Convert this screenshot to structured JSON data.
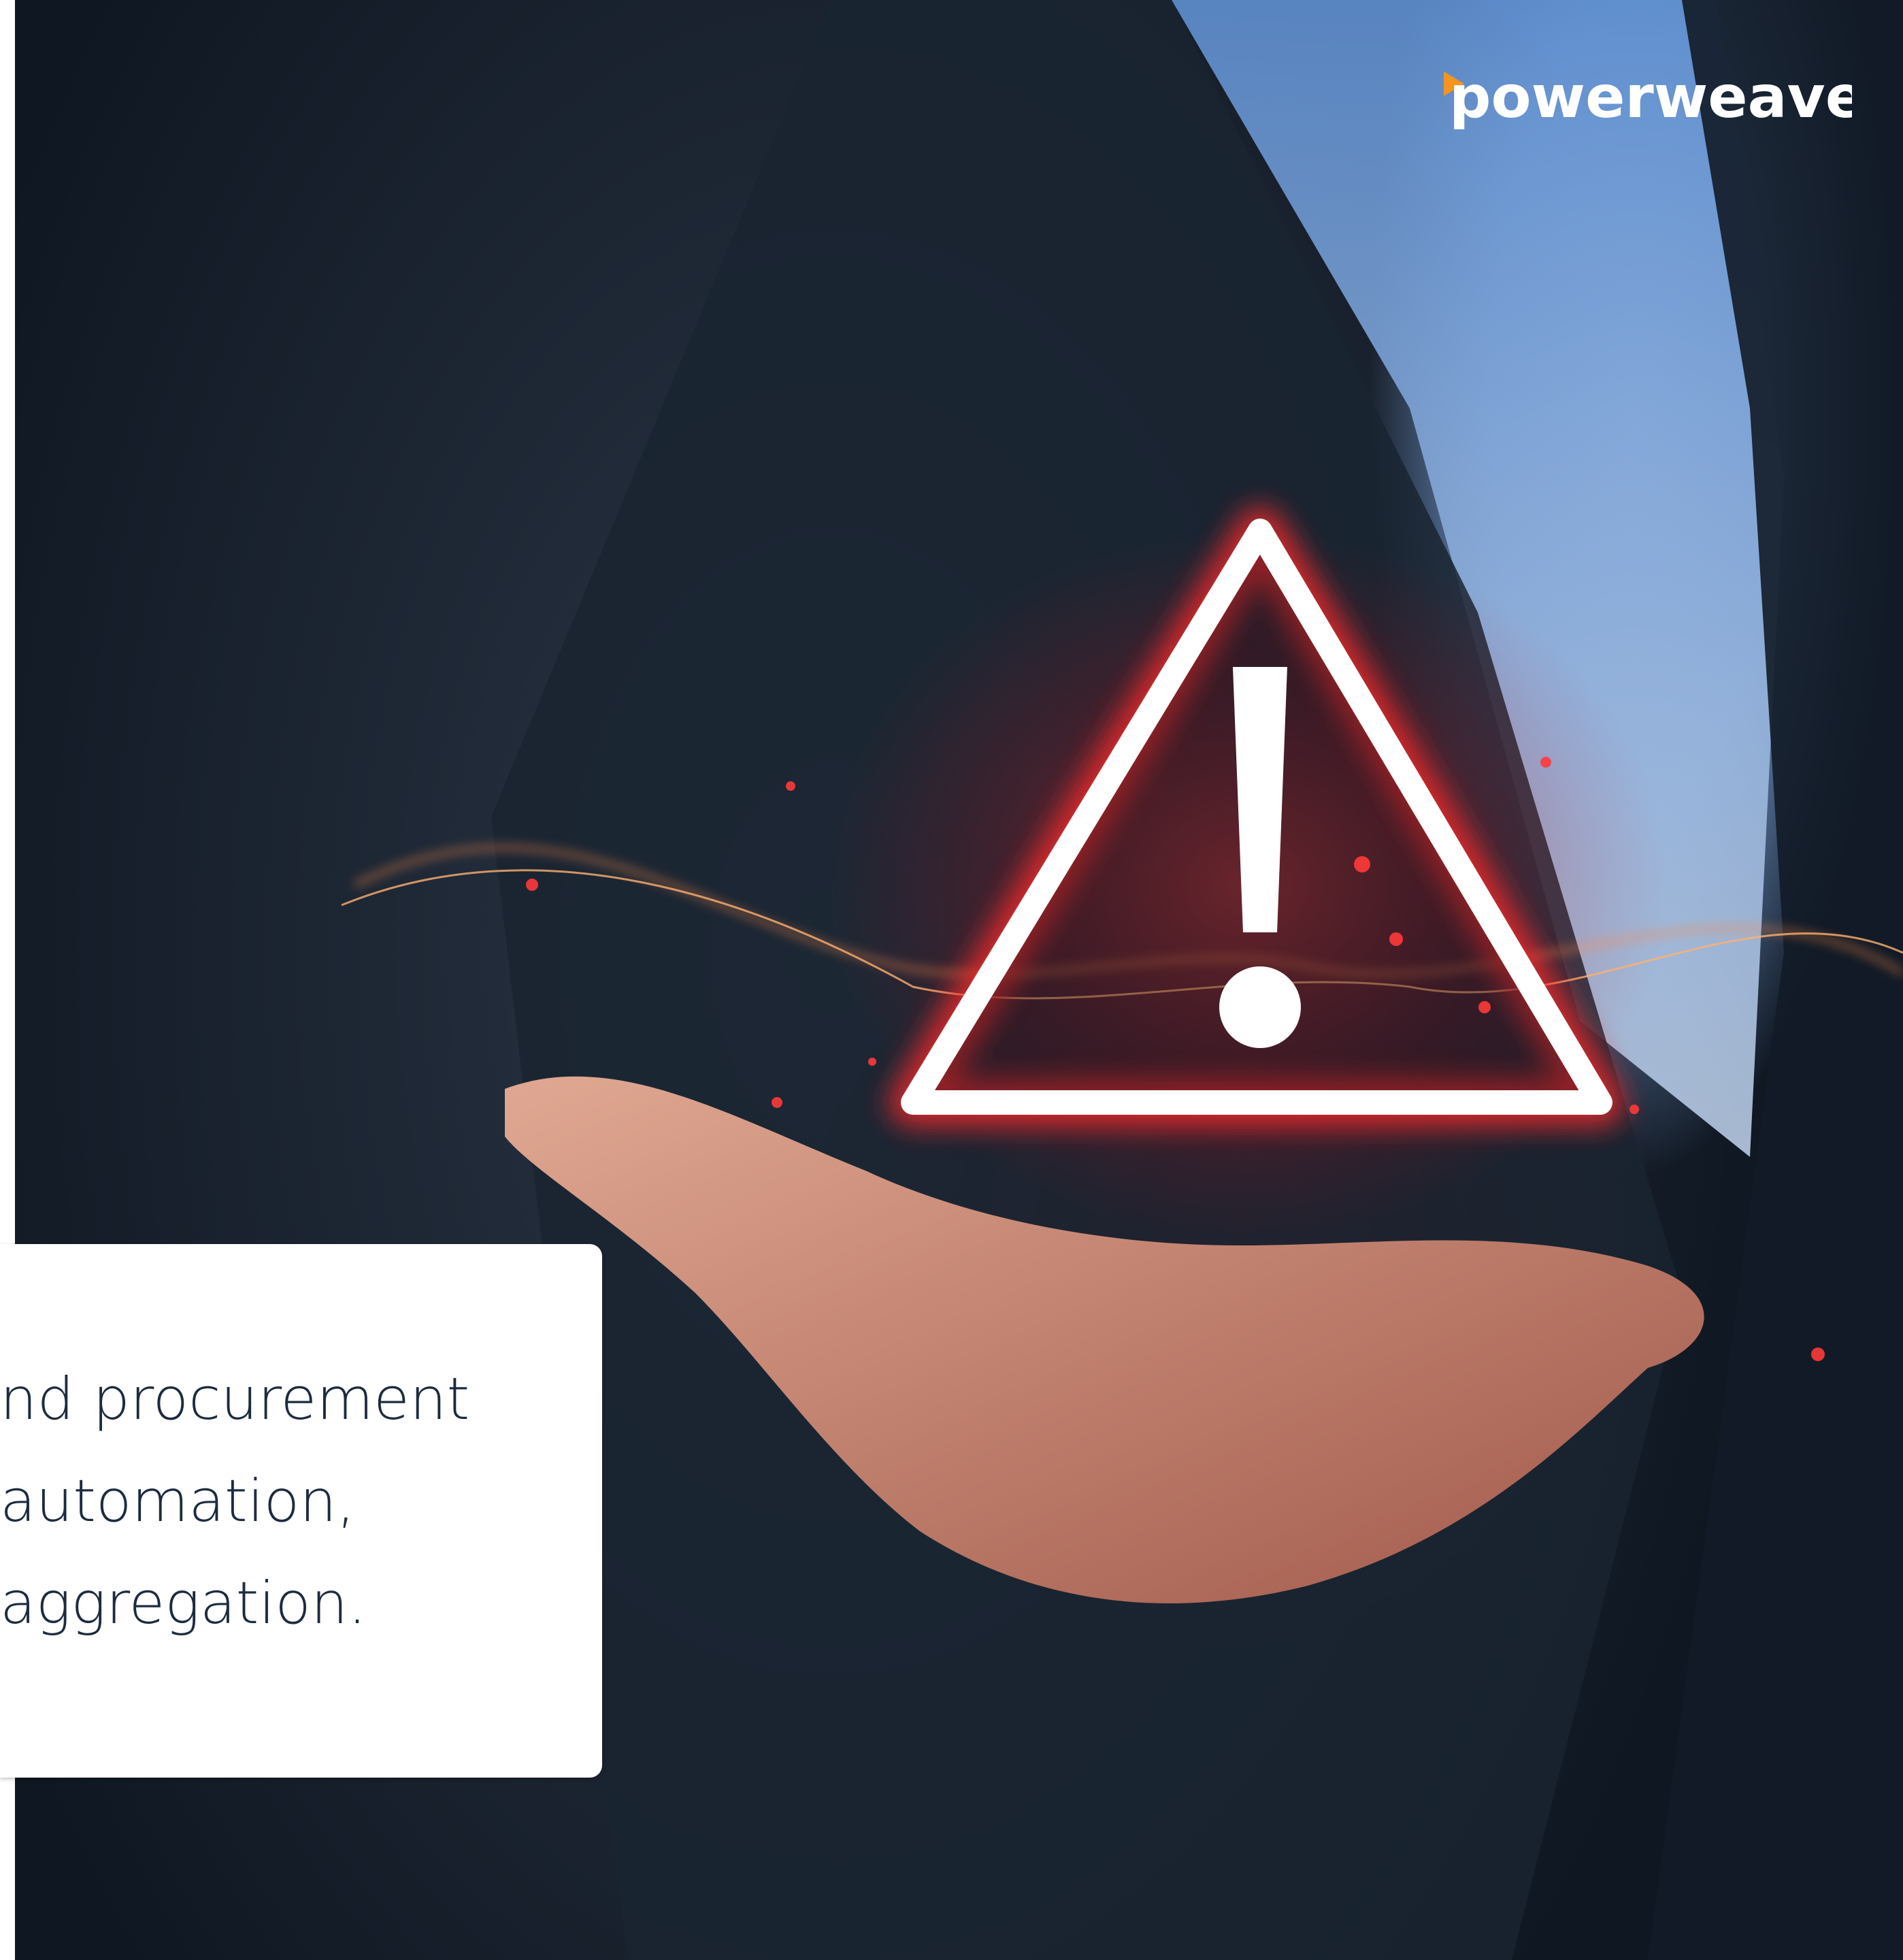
{
  "brand": {
    "logo_text": "powerweave",
    "logo_text_color": "#ffffff",
    "logo_accent_color": "#f7941d"
  },
  "hero": {
    "image_description_icon": "warning-triangle-icon",
    "warning_color": "#e8141e"
  },
  "card": {
    "lines": [
      "nd procurement",
      "automation,",
      "aggregation."
    ],
    "text_color": "#1c2b3f"
  }
}
